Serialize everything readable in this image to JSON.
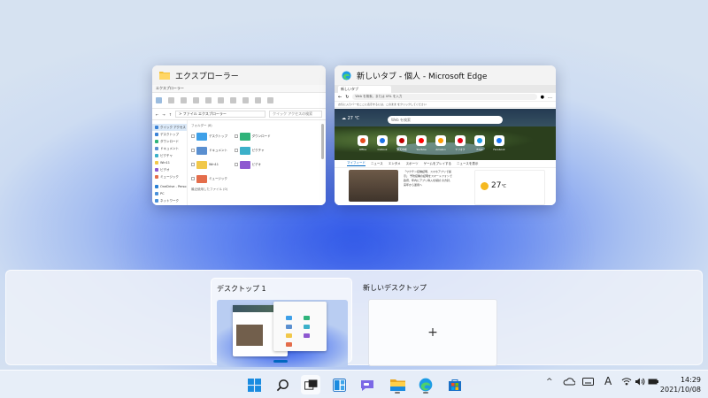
{
  "windows": {
    "explorer": {
      "title": "エクスプローラー",
      "inner_title": "エクスプローラー",
      "address": "> ファイル エクスプローラー",
      "search_placeholder": "クイック アクセスの検索",
      "sidebar": [
        "クイック アクセス",
        "デスクトップ",
        "ダウンロード",
        "ドキュメント",
        "ピクチャ",
        "Win11",
        "ビデオ",
        "ミュージック",
        "OneDrive - Perso",
        "PC",
        "ネットワーク"
      ],
      "group_label": "フォルダー (8)",
      "recent_label": "最近使用したファイル (0)",
      "folders": [
        {
          "name": "デスクトップ",
          "color": "#3ea0e8"
        },
        {
          "name": "ダウンロード",
          "color": "#2fb37a"
        },
        {
          "name": "ドキュメント",
          "color": "#5a8fd0"
        },
        {
          "name": "ピクチャ",
          "color": "#3bb0c9"
        },
        {
          "name": "ミュージック",
          "color": "#e46d4b"
        },
        {
          "name": "ビデオ",
          "color": "#8e58d0"
        },
        {
          "name": "Win11",
          "color": "#f1c84a"
        }
      ]
    },
    "edge": {
      "title": "新しいタブ - 個人 - Microsoft Edge",
      "tab_label": "新しいタブ",
      "address_placeholder": "Web を検索、または URL を入力",
      "favbar": "お気に入りバーをここに表示するには、このまま をクリックしてください",
      "weather_top": "☁ 27 ℃",
      "search_placeholder": "Web を検索",
      "quick_links": [
        {
          "label": "Office",
          "color": "#e74c1c"
        },
        {
          "label": "Outlook",
          "color": "#1a73e8"
        },
        {
          "label": "楽天市場",
          "color": "#bf0000"
        },
        {
          "label": "YouTube",
          "color": "#ff0000"
        },
        {
          "label": "Amazon",
          "color": "#ff9900"
        },
        {
          "label": "ヤフオク",
          "color": "#e60012"
        },
        {
          "label": "Edge",
          "color": "#1c9be6"
        },
        {
          "label": "Facebook",
          "color": "#1877f2"
        }
      ],
      "nav": [
        "マイフィード",
        "ニュース",
        "エンタメ",
        "スポーツ",
        "ゲームをプレイする",
        "ニュースを表示"
      ],
      "news_text": "「ワクチン接種証明、スマホアプリで提示」 予防接種の証明をスマートフォンで 政府、年内にアプリ導入を検討 の方針、来年から運用へ",
      "weather_card": {
        "temp": "27",
        "unit": "℃"
      }
    }
  },
  "desktops": [
    {
      "label": "デスクトップ 1",
      "active": true
    },
    {
      "label": "新しいデスクトップ",
      "plus": "+"
    }
  ],
  "taskbar": {
    "clock_time": "14:29",
    "clock_date": "2021/10/08",
    "ime": "A",
    "tray_up": "^"
  }
}
